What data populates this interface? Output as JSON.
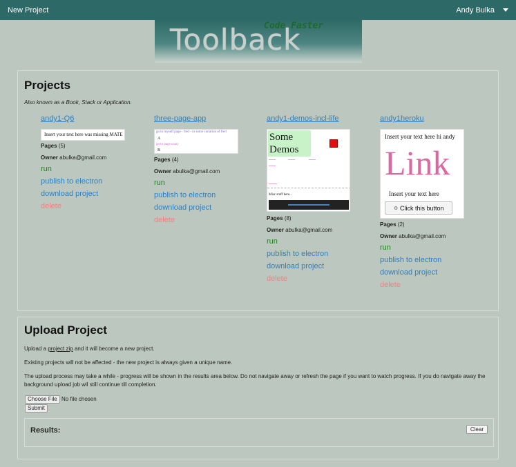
{
  "topbar": {
    "brand": "New Project",
    "user": "Andy Bulka"
  },
  "logo": {
    "main": "Toolback",
    "tagline": "Code Faster"
  },
  "projects": {
    "heading": "Projects",
    "subtitle": "Also known as a Book, Stack or Application.",
    "items": [
      {
        "title": "andy1-Q6",
        "thumb_text": "Insert your text here was missing MATE",
        "pages_label": "Pages",
        "pages": "(5)",
        "owner_label": "Owner",
        "owner": "abulka@gmail.com"
      },
      {
        "title": "three-page-app",
        "thumb_line1": "go to myself page - fred - or some variation of fred",
        "thumb_a": "A",
        "thumb_line2": "go to page crazy",
        "thumb_b": "B",
        "pages_label": "Pages",
        "pages": "(4)",
        "owner_label": "Owner",
        "owner": "abulka@gmail.com"
      },
      {
        "title": "andy1-demos-incl-life",
        "thumb_some": "Some",
        "thumb_demos": "Demos",
        "thumb_misc": "Misc stuff here...",
        "pages_label": "Pages",
        "pages": "(8)",
        "owner_label": "Owner",
        "owner": "abulka@gmail.com"
      },
      {
        "title": "andy1heroku",
        "thumb_top": "Insert your text here hi andy",
        "thumb_link": "Link",
        "thumb_bottom": "Insert your text here",
        "thumb_button": "Click this button",
        "pages_label": "Pages",
        "pages": "(2)",
        "owner_label": "Owner",
        "owner": "abulka@gmail.com"
      }
    ],
    "actions": {
      "run": "run",
      "publish": "publish to electron",
      "download": "download project",
      "delete": "delete"
    }
  },
  "upload": {
    "heading": "Upload Project",
    "line1_pre": "Upload a ",
    "line1_link": "project zip",
    "line1_post": " and it will become a new project.",
    "line2": "Existing projects will not be affected - the new project is always given a unique name.",
    "line3": "The upload process may take a while - progress will be shown in the results area below. Do not navigate away or refresh the page if you want to watch progress. If you do navigate away the background upload job wil still continue till completion.",
    "choose_file": "Choose File",
    "no_file": "No file chosen",
    "submit": "Submit",
    "results_label": "Results:",
    "clear": "Clear"
  },
  "colors": {
    "topbar": "#2d6a67",
    "link": "#2d7fbf",
    "run": "#1b8a1b",
    "delete": "#f08080",
    "background": "#bcc8bf"
  }
}
